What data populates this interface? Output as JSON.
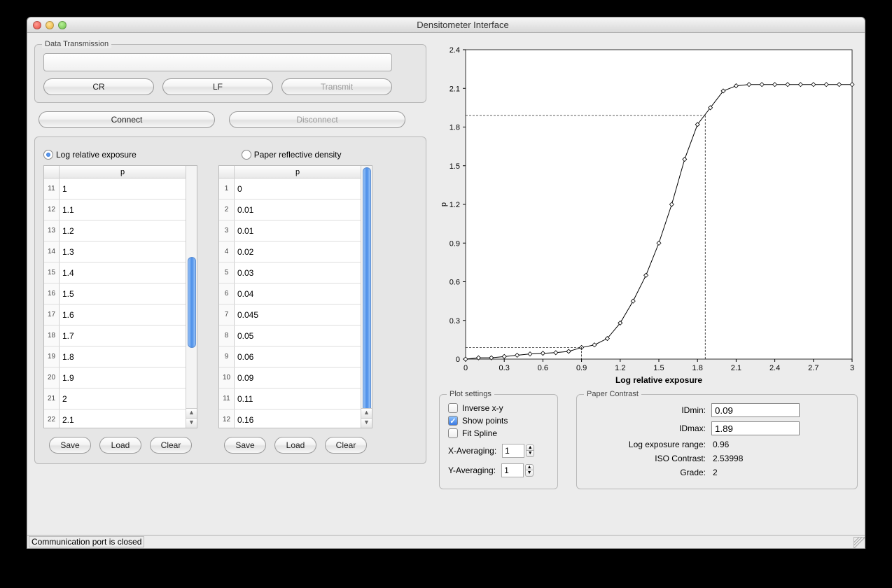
{
  "window": {
    "title": "Densitometer Interface"
  },
  "transmission": {
    "legend": "Data Transmission",
    "cr": "CR",
    "lf": "LF",
    "transmit": "Transmit"
  },
  "connect": {
    "connect": "Connect",
    "disconnect": "Disconnect"
  },
  "tables": {
    "radio1": "Log relative exposure",
    "radio2": "Paper reflective density",
    "header": "p",
    "left_idx": [
      11,
      12,
      13,
      14,
      15,
      16,
      17,
      18,
      19,
      20,
      21,
      22
    ],
    "left_val": [
      "1",
      "1.1",
      "1.2",
      "1.3",
      "1.4",
      "1.5",
      "1.6",
      "1.7",
      "1.8",
      "1.9",
      "2",
      "2.1"
    ],
    "right_idx": [
      1,
      2,
      3,
      4,
      5,
      6,
      7,
      8,
      9,
      10,
      11,
      12
    ],
    "right_val": [
      "0",
      "0.01",
      "0.01",
      "0.02",
      "0.03",
      "0.04",
      "0.045",
      "0.05",
      "0.06",
      "0.09",
      "0.11",
      "0.16"
    ],
    "save": "Save",
    "load": "Load",
    "clear": "Clear"
  },
  "plot_settings": {
    "legend": "Plot settings",
    "inverse": "Inverse x-y",
    "show_points": "Show points",
    "fit_spline": "Fit Spline",
    "xavg_label": "X-Averaging:",
    "yavg_label": "Y-Averaging:",
    "xavg": "1",
    "yavg": "1"
  },
  "contrast": {
    "legend": "Paper Contrast",
    "idmin_label": "IDmin:",
    "idmin": "0.09",
    "idmax_label": "IDmax:",
    "idmax": "1.89",
    "ler_label": "Log exposure range:",
    "ler": "0.96",
    "iso_label": "ISO Contrast:",
    "iso": "2.53998",
    "grade_label": "Grade:",
    "grade": "2"
  },
  "chart_data": {
    "type": "line",
    "title": "",
    "xlabel": "Log relative exposure",
    "ylabel": "p",
    "xlim": [
      0,
      3
    ],
    "ylim": [
      0,
      2.4
    ],
    "xticks": [
      0,
      0.3,
      0.6,
      0.9,
      1.2,
      1.5,
      1.8,
      2.1,
      2.4,
      2.7,
      3
    ],
    "yticks": [
      0,
      0.3,
      0.6,
      0.9,
      1.2,
      1.5,
      1.8,
      2.1,
      2.4
    ],
    "x": [
      0,
      0.1,
      0.2,
      0.3,
      0.4,
      0.5,
      0.6,
      0.7,
      0.8,
      0.9,
      1.0,
      1.1,
      1.2,
      1.3,
      1.4,
      1.5,
      1.6,
      1.7,
      1.8,
      1.9,
      2.0,
      2.1,
      2.2,
      2.3,
      2.4,
      2.5,
      2.6,
      2.7,
      2.8,
      2.9,
      3.0
    ],
    "y": [
      0,
      0.01,
      0.01,
      0.02,
      0.03,
      0.04,
      0.045,
      0.05,
      0.06,
      0.09,
      0.11,
      0.16,
      0.28,
      0.45,
      0.65,
      0.9,
      1.2,
      1.55,
      1.82,
      1.95,
      2.08,
      2.12,
      2.13,
      2.13,
      2.13,
      2.13,
      2.13,
      2.13,
      2.13,
      2.13,
      2.13
    ],
    "ref_lines": {
      "idmin": {
        "y": 0.09,
        "x": 0.9
      },
      "idmax": {
        "y": 1.89,
        "x": 1.86
      }
    }
  },
  "status": "Communication port is closed"
}
